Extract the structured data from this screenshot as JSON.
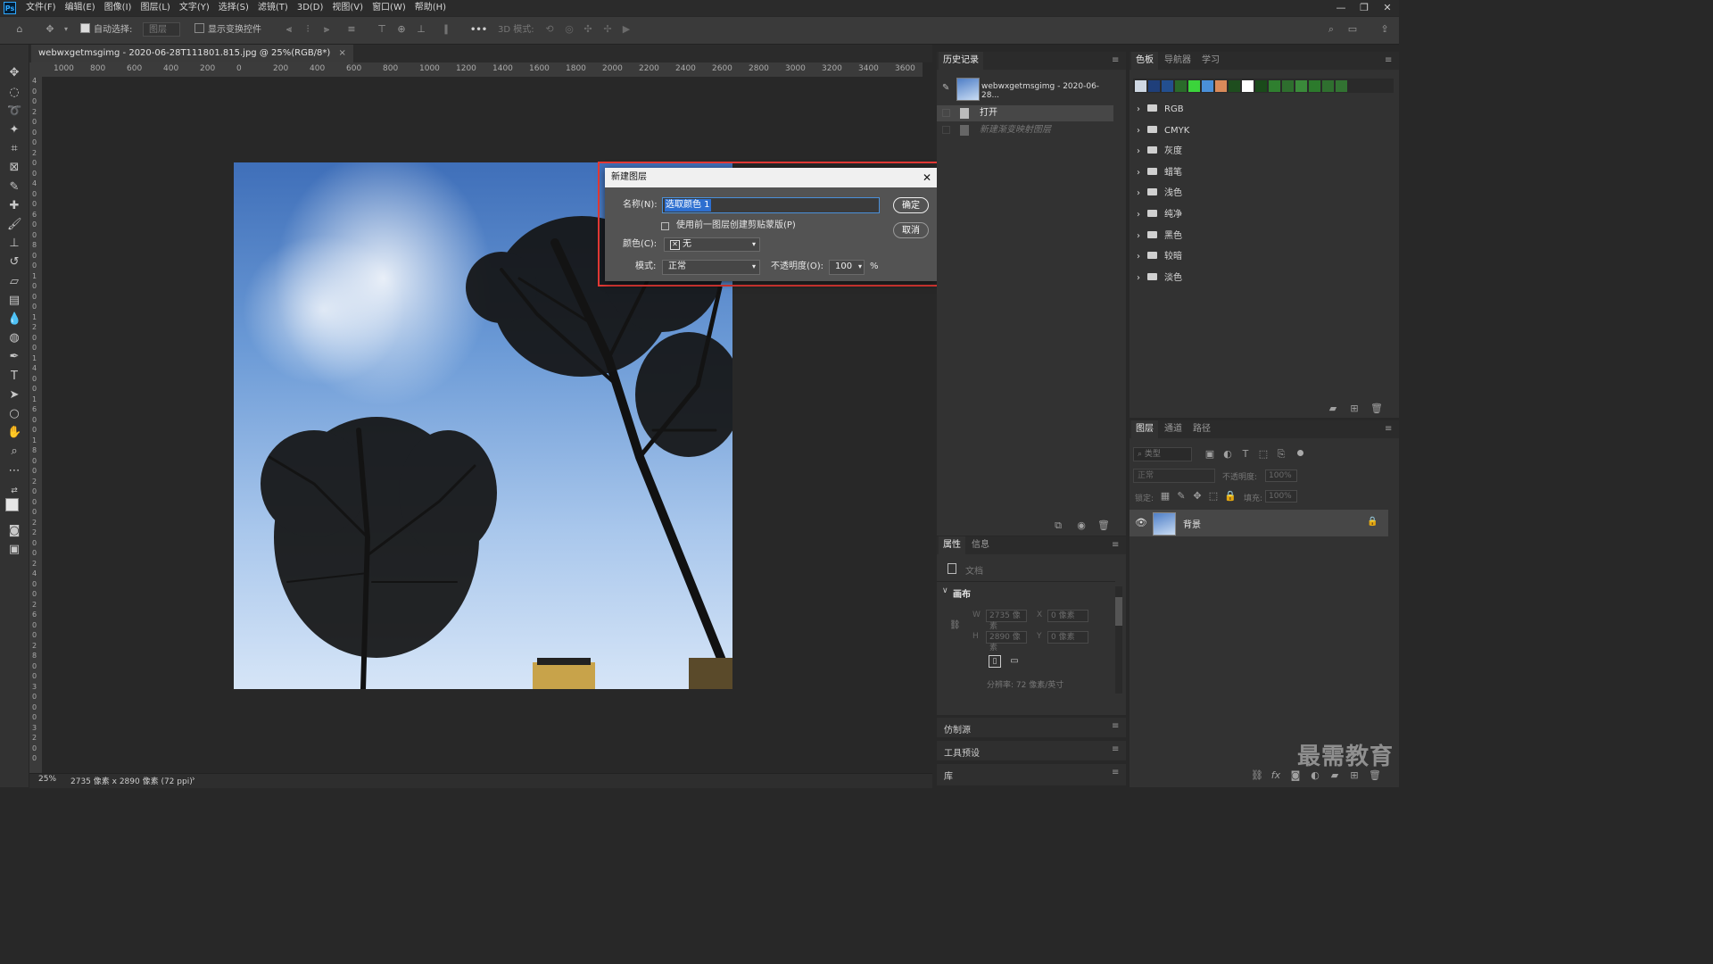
{
  "menubar": {
    "logo": "Ps",
    "items": [
      "文件(F)",
      "编辑(E)",
      "图像(I)",
      "图层(L)",
      "文字(Y)",
      "选择(S)",
      "滤镜(T)",
      "3D(D)",
      "视图(V)",
      "窗口(W)",
      "帮助(H)"
    ],
    "window_controls": [
      "—",
      "❐",
      "✕"
    ]
  },
  "optbar": {
    "auto_select_label": "自动选择:",
    "auto_select_target": "图层",
    "show_transform_label": "显示变换控件",
    "mode_3d_label": "3D 模式:",
    "more": "•••"
  },
  "document": {
    "tab_label": "webwxgetmsgimg - 2020-06-28T111801.815.jpg @ 25%(RGB/8*)",
    "close": "×",
    "zoom": "25%",
    "doc_info": "2735 像素 x 2890 像素 (72 ppi)",
    "status_arrow": "›"
  },
  "ruler": {
    "h_ticks": [
      "1000",
      "800",
      "600",
      "400",
      "200",
      "0",
      "200",
      "400",
      "600",
      "800",
      "1000",
      "1200",
      "1400",
      "1600",
      "1800",
      "2000",
      "2200",
      "2400",
      "2600",
      "2800",
      "3000",
      "3200",
      "3400",
      "3600"
    ],
    "v_ticks": [
      "4",
      "0",
      "0",
      "2",
      "0",
      "0",
      "0",
      "2",
      "0",
      "0",
      "4",
      "0",
      "0",
      "6",
      "0",
      "0",
      "8",
      "0",
      "0",
      "1",
      "0",
      "0",
      "0",
      "1",
      "2",
      "0",
      "0",
      "1",
      "4",
      "0",
      "0",
      "1",
      "6",
      "0",
      "0",
      "1",
      "8",
      "0",
      "0",
      "2",
      "0",
      "0",
      "0",
      "2",
      "2",
      "0",
      "0",
      "2",
      "4",
      "0",
      "0",
      "2",
      "6",
      "0",
      "0",
      "2",
      "8",
      "0",
      "0",
      "3",
      "0",
      "0",
      "0",
      "3",
      "2",
      "0",
      "0"
    ]
  },
  "dialog": {
    "title": "新建图层",
    "close": "✕",
    "name_label": "名称(N):",
    "name_value": "选取颜色 1",
    "clip_label": "使用前一图层创建剪贴蒙版(P)",
    "color_label": "颜色(C):",
    "color_value": "无",
    "mode_label": "模式:",
    "mode_value": "正常",
    "opacity_label": "不透明度(O):",
    "opacity_value": "100",
    "opacity_unit": "%",
    "ok": "确定",
    "cancel": "取消"
  },
  "history": {
    "tab": "历史记录",
    "snapshot": "webwxgetmsgimg - 2020-06-28...",
    "items": [
      "打开",
      "新建渐变映射图层"
    ]
  },
  "swatches": {
    "tabs": [
      "色板",
      "导航器",
      "学习"
    ],
    "colors": [
      "#cfd8e3",
      "#1f3f7a",
      "#234f8f",
      "#2a6a2a",
      "#3bd43b",
      "#4a90d9",
      "#d98a5a",
      "#1e4d1e",
      "#ffffff",
      "#1a4a1a",
      "#2f7f2f",
      "#2e6e2e",
      "#3a8a3a",
      "#2c7a2c",
      "#2f6f2f",
      "#327332"
    ],
    "groups": [
      "RGB",
      "CMYK",
      "灰度",
      "蜡笔",
      "浅色",
      "纯净",
      "黑色",
      "较暗",
      "淡色"
    ]
  },
  "properties": {
    "tabs": [
      "属性",
      "信息"
    ],
    "doc_label": "文档",
    "canvas_label": "画布",
    "w_label": "W",
    "w_value": "2735 像素",
    "h_label": "H",
    "h_value": "2890 像素",
    "x_label": "X",
    "x_value": "0 像素",
    "y_label": "Y",
    "y_value": "0 像素",
    "resolution": "分辨率: 72 像素/英寸"
  },
  "collapsed_panels": [
    "仿制源",
    "工具预设",
    "库"
  ],
  "layers": {
    "tabs": [
      "图层",
      "通道",
      "路径"
    ],
    "filter_placeholder": "类型",
    "blend_mode": "正常",
    "opacity_label": "不透明度:",
    "opacity_value": "100%",
    "lock_label": "锁定:",
    "fill_label": "填充:",
    "fill_value": "100%",
    "layer_name": "背景"
  },
  "watermark": "最需教育"
}
